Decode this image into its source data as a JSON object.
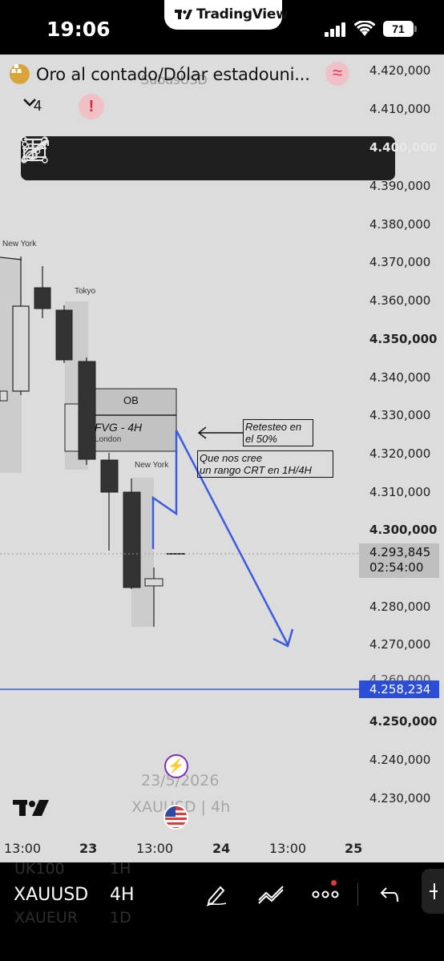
{
  "status": {
    "time": "19:06",
    "app_pill": "TradingView",
    "battery": "71"
  },
  "chart": {
    "symbol_title": "Oro al contado/Dólar estadouni...",
    "symbol_sub": "SubasUSD",
    "indicator_count": "4",
    "price_axis": [
      "4.420,000",
      "4.410,000",
      "4.400,000",
      "4.390,000",
      "4.380,000",
      "4.370,000",
      "4.360,000",
      "4.350,000",
      "4.340,000",
      "4.330,000",
      "4.320,000",
      "4.310,000",
      "4.300,000",
      "4.280,000",
      "4.270,000",
      "4.260,000",
      "4.250,000",
      "4.240,000",
      "4.230,000"
    ],
    "current_price": "4.293,845",
    "countdown": "02:54:00",
    "line_price": "4.258,234",
    "time_axis": [
      "13:00",
      "23",
      "13:00",
      "24",
      "13:00",
      "25"
    ],
    "session_labels": [
      "New York",
      "Tokyo",
      "London",
      "New York"
    ],
    "zones": [
      "OB",
      "FVG - 4H"
    ],
    "annotations": [
      "Retesteo en",
      "el 50%",
      "Que nos cree",
      "un rango CRT en 1H/4H"
    ],
    "watermark_date": "23/5/2026",
    "watermark_symbol": "XAUUSD | 4h",
    "colors": {
      "line_blue": "#3b5be0",
      "price_box_blue": "#2c4ed6",
      "background": "#dcdcdc"
    }
  },
  "toolbar_tools": [
    "long-position-icon",
    "short-position-icon",
    "rectangle-icon",
    "trend-line-icon",
    "horizontal-ray-icon",
    "text-icon",
    "path-icon",
    "brush-icon"
  ],
  "bottom": {
    "symbol": "XAUUSD",
    "timeframe": "4H",
    "ghost_top": [
      "UK100",
      "1H"
    ],
    "ghost_bottom": [
      "XAUEUR",
      "1D"
    ]
  }
}
